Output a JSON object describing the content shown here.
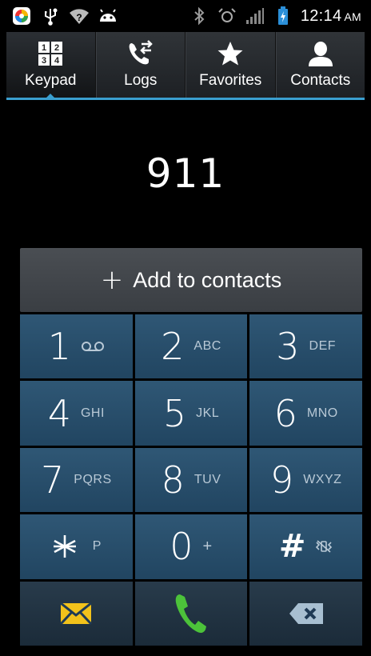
{
  "status_bar": {
    "time": "12:14",
    "ampm": "AM",
    "icons": [
      "app-launcher-icon",
      "usb-icon",
      "wifi-question-icon",
      "android-icon",
      "bluetooth-icon",
      "nfc-icon",
      "signal-icon",
      "battery-charging-icon"
    ]
  },
  "tabs": [
    {
      "label": "Keypad",
      "icon": "keypad-icon",
      "active": true
    },
    {
      "label": "Logs",
      "icon": "logs-icon",
      "active": false
    },
    {
      "label": "Favorites",
      "icon": "star-icon",
      "active": false
    },
    {
      "label": "Contacts",
      "icon": "person-icon",
      "active": false
    }
  ],
  "dialer": {
    "number": "911",
    "add_to_contacts": "Add to contacts"
  },
  "keypad": {
    "keys": [
      {
        "digit": "1",
        "letters": ""
      },
      {
        "digit": "2",
        "letters": "ABC"
      },
      {
        "digit": "3",
        "letters": "DEF"
      },
      {
        "digit": "4",
        "letters": "GHI"
      },
      {
        "digit": "5",
        "letters": "JKL"
      },
      {
        "digit": "6",
        "letters": "MNO"
      },
      {
        "digit": "7",
        "letters": "PQRS"
      },
      {
        "digit": "8",
        "letters": "TUV"
      },
      {
        "digit": "9",
        "letters": "WXYZ"
      },
      {
        "digit": "*",
        "letters": "P"
      },
      {
        "digit": "0",
        "letters": "+"
      },
      {
        "digit": "#",
        "letters": ""
      }
    ]
  },
  "colors": {
    "accent": "#3a9fcf",
    "key_bg": "#2a4f6c",
    "call_green": "#4cc23a",
    "message_yellow": "#f2c21b"
  }
}
